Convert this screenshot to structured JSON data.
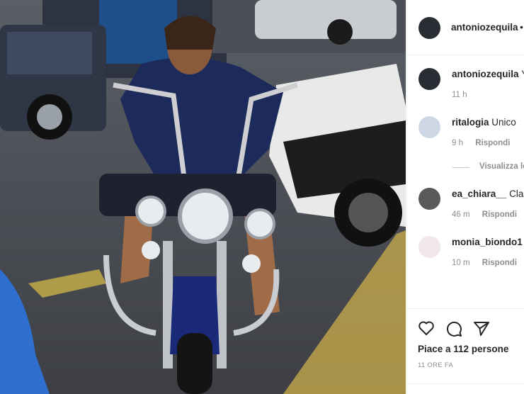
{
  "post": {
    "author": "antoniozequila",
    "header_dot": "•"
  },
  "caption": {
    "username": "antoniozequila",
    "text": "Y",
    "time": "11 h"
  },
  "comments": [
    {
      "username": "ritalogia",
      "text": "Unico",
      "time": "9 h",
      "reply": "Rispondi"
    },
    {
      "username": "ea_chiara__",
      "text": "Class",
      "time": "46 m",
      "reply": "Rispondi"
    },
    {
      "username": "monia_biondo1",
      "text": "-",
      "time": "10 m",
      "reply": "Rispondi"
    }
  ],
  "view_replies": "Visualizza le",
  "likes_text": "Piace a 112 persone",
  "post_time": "11 ORE FA",
  "icons": {
    "like": "heart-icon",
    "comment": "comment-bubble-icon",
    "share": "paper-plane-icon"
  }
}
